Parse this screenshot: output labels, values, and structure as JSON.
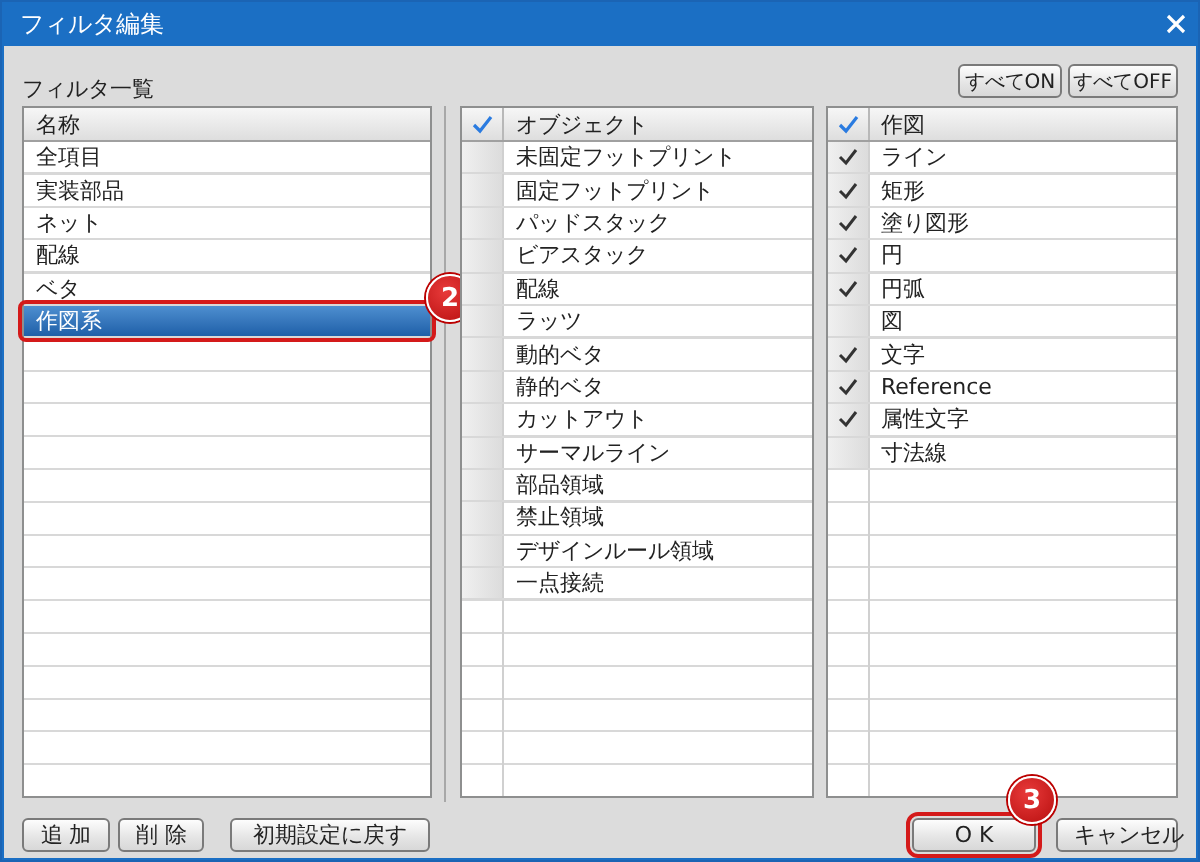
{
  "window": {
    "title": "フィルタ編集"
  },
  "filter_list": {
    "label": "フィルタ一覧",
    "header": "名称",
    "items": [
      {
        "name": "全項目",
        "selected": false
      },
      {
        "name": "実装部品",
        "selected": false
      },
      {
        "name": "ネット",
        "selected": false
      },
      {
        "name": "配線",
        "selected": false
      },
      {
        "name": "ベタ",
        "selected": false
      },
      {
        "name": "作図系",
        "selected": true,
        "callout": "2"
      }
    ]
  },
  "toggle_buttons": [
    "すべてON",
    "すべてOFF"
  ],
  "object_list": {
    "header": "オブジェクト",
    "items": [
      {
        "name": "未固定フットプリント",
        "checked": false
      },
      {
        "name": "固定フットプリント",
        "checked": false
      },
      {
        "name": "パッドスタック",
        "checked": false
      },
      {
        "name": "ビアスタック",
        "checked": false
      },
      {
        "name": "配線",
        "checked": false
      },
      {
        "name": "ラッツ",
        "checked": false
      },
      {
        "name": "動的ベタ",
        "checked": false
      },
      {
        "name": "静的ベタ",
        "checked": false
      },
      {
        "name": "カットアウト",
        "checked": false
      },
      {
        "name": "サーマルライン",
        "checked": false
      },
      {
        "name": "部品領域",
        "checked": false
      },
      {
        "name": "禁止領域",
        "checked": false
      },
      {
        "name": "デザインルール領域",
        "checked": false
      },
      {
        "name": "一点接続",
        "checked": false
      }
    ]
  },
  "drawing_list": {
    "header": "作図",
    "items": [
      {
        "name": "ライン",
        "checked": true
      },
      {
        "name": "矩形",
        "checked": true
      },
      {
        "name": "塗り図形",
        "checked": true
      },
      {
        "name": "円",
        "checked": true
      },
      {
        "name": "円弧",
        "checked": true
      },
      {
        "name": "図",
        "checked": false
      },
      {
        "name": "文字",
        "checked": true
      },
      {
        "name": "Reference",
        "checked": true
      },
      {
        "name": "属性文字",
        "checked": true
      },
      {
        "name": "寸法線",
        "checked": false
      }
    ]
  },
  "left_buttons": [
    {
      "label": "追 加"
    },
    {
      "label": "削 除"
    },
    {
      "label": "初期設定に戻す"
    }
  ],
  "right_buttons": [
    {
      "label": "O K",
      "callout": "3"
    },
    {
      "label": "キャンセル"
    }
  ]
}
